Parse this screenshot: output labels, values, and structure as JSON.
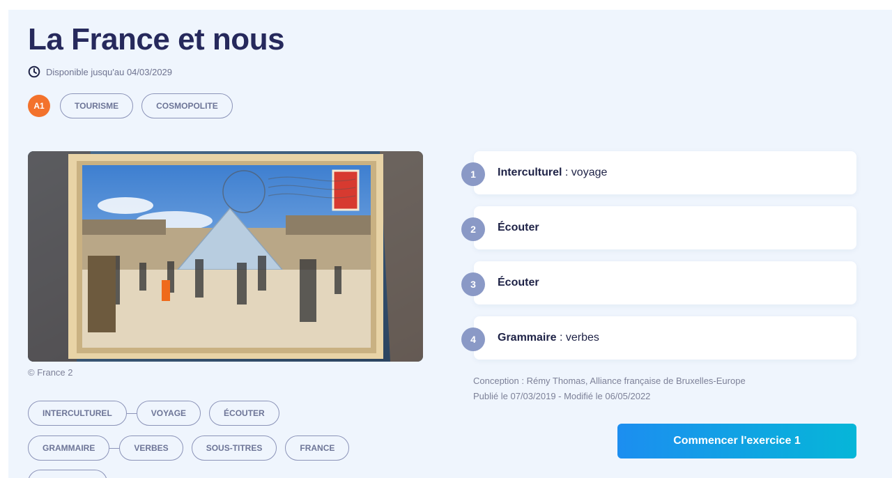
{
  "page": {
    "title": "La France et nous",
    "availability": "Disponible jusqu'au 04/03/2029",
    "level": "A1",
    "top_tags": [
      "TOURISME",
      "COSMOPOLITE"
    ]
  },
  "media": {
    "image_icon": "louvre-postcard-photo",
    "credit": "© France 2"
  },
  "tags": {
    "row1": [
      "INTERCULTUREL",
      "VOYAGE",
      "ÉCOUTER"
    ],
    "row2": [
      "GRAMMAIRE",
      "VERBES",
      "SOUS-TITRES",
      "FRANCE"
    ]
  },
  "steps": [
    {
      "number": "1",
      "title": "Interculturel",
      "detail": " : voyage"
    },
    {
      "number": "2",
      "title": "Écouter",
      "detail": ""
    },
    {
      "number": "3",
      "title": "Écouter",
      "detail": ""
    },
    {
      "number": "4",
      "title": "Grammaire",
      "detail": " : verbes"
    }
  ],
  "meta": {
    "conception": "Conception : Rémy Thomas, Alliance française de Bruxelles-Europe",
    "dates": "Publié le 07/03/2019 - Modifié le 06/05/2022"
  },
  "cta": {
    "label": "Commencer l'exercice 1"
  },
  "colors": {
    "title": "#26295c",
    "level_badge": "#f3722c",
    "step_badge": "#8a99c6",
    "cta_start": "#1c8ef0",
    "cta_end": "#06b6d8",
    "background": "#eff5fd"
  }
}
